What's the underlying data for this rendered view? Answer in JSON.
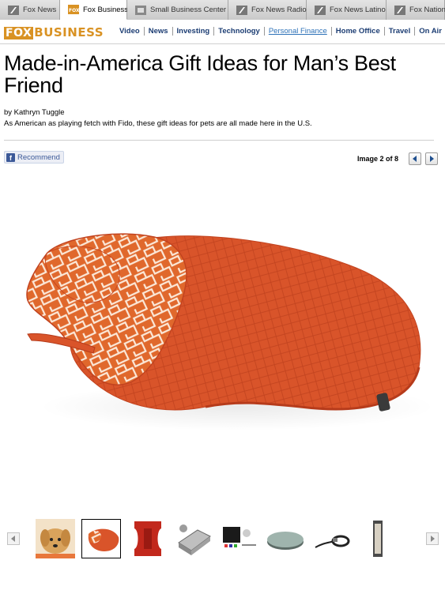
{
  "network_tabs": [
    {
      "label": "Fox News",
      "active": false,
      "icon": "fox-news-icon"
    },
    {
      "label": "Fox Business",
      "active": true,
      "icon": "fox-business-icon"
    },
    {
      "label": "Small Business Center",
      "active": false,
      "icon": "small-business-icon"
    },
    {
      "label": "Fox News Radio",
      "active": false,
      "icon": "fox-radio-icon"
    },
    {
      "label": "Fox News Latino",
      "active": false,
      "icon": "fox-latino-icon"
    },
    {
      "label": "Fox Nation",
      "active": false,
      "icon": "fox-nation-icon"
    }
  ],
  "site": {
    "logo_box": "FOX",
    "logo_text": "BUSINESS",
    "nav": [
      {
        "label": "Video",
        "selected": false
      },
      {
        "label": "News",
        "selected": false
      },
      {
        "label": "Investing",
        "selected": false
      },
      {
        "label": "Technology",
        "selected": false
      },
      {
        "label": "Personal Finance",
        "selected": true
      },
      {
        "label": "Home Office",
        "selected": false
      },
      {
        "label": "Travel",
        "selected": false
      },
      {
        "label": "On Air",
        "selected": false
      }
    ]
  },
  "article": {
    "title": "Made-in-America Gift Ideas for Man’s Best Friend",
    "byline": "by Kathryn Tuggle",
    "dek": "As American as playing fetch with Fido, these gift ideas for pets are all made here in the U.S."
  },
  "gallery": {
    "recommend_label": "Recommend",
    "counter": "Image 2 of 8",
    "current_index": 2,
    "total": 8,
    "thumbnails": [
      {
        "name": "puppy",
        "selected": false
      },
      {
        "name": "dog-coat",
        "selected": true
      },
      {
        "name": "red-chew-toy",
        "selected": false
      },
      {
        "name": "pet-carrier",
        "selected": false
      },
      {
        "name": "grooming-kit",
        "selected": false
      },
      {
        "name": "pet-bed",
        "selected": false
      },
      {
        "name": "collar-leash",
        "selected": false
      },
      {
        "name": "tall-panel",
        "selected": false
      }
    ]
  },
  "colors": {
    "brand_gold": "#d99223",
    "nav_blue": "#1c3d73",
    "coat_orange": "#d9542a",
    "facebook_blue": "#3b5998"
  }
}
